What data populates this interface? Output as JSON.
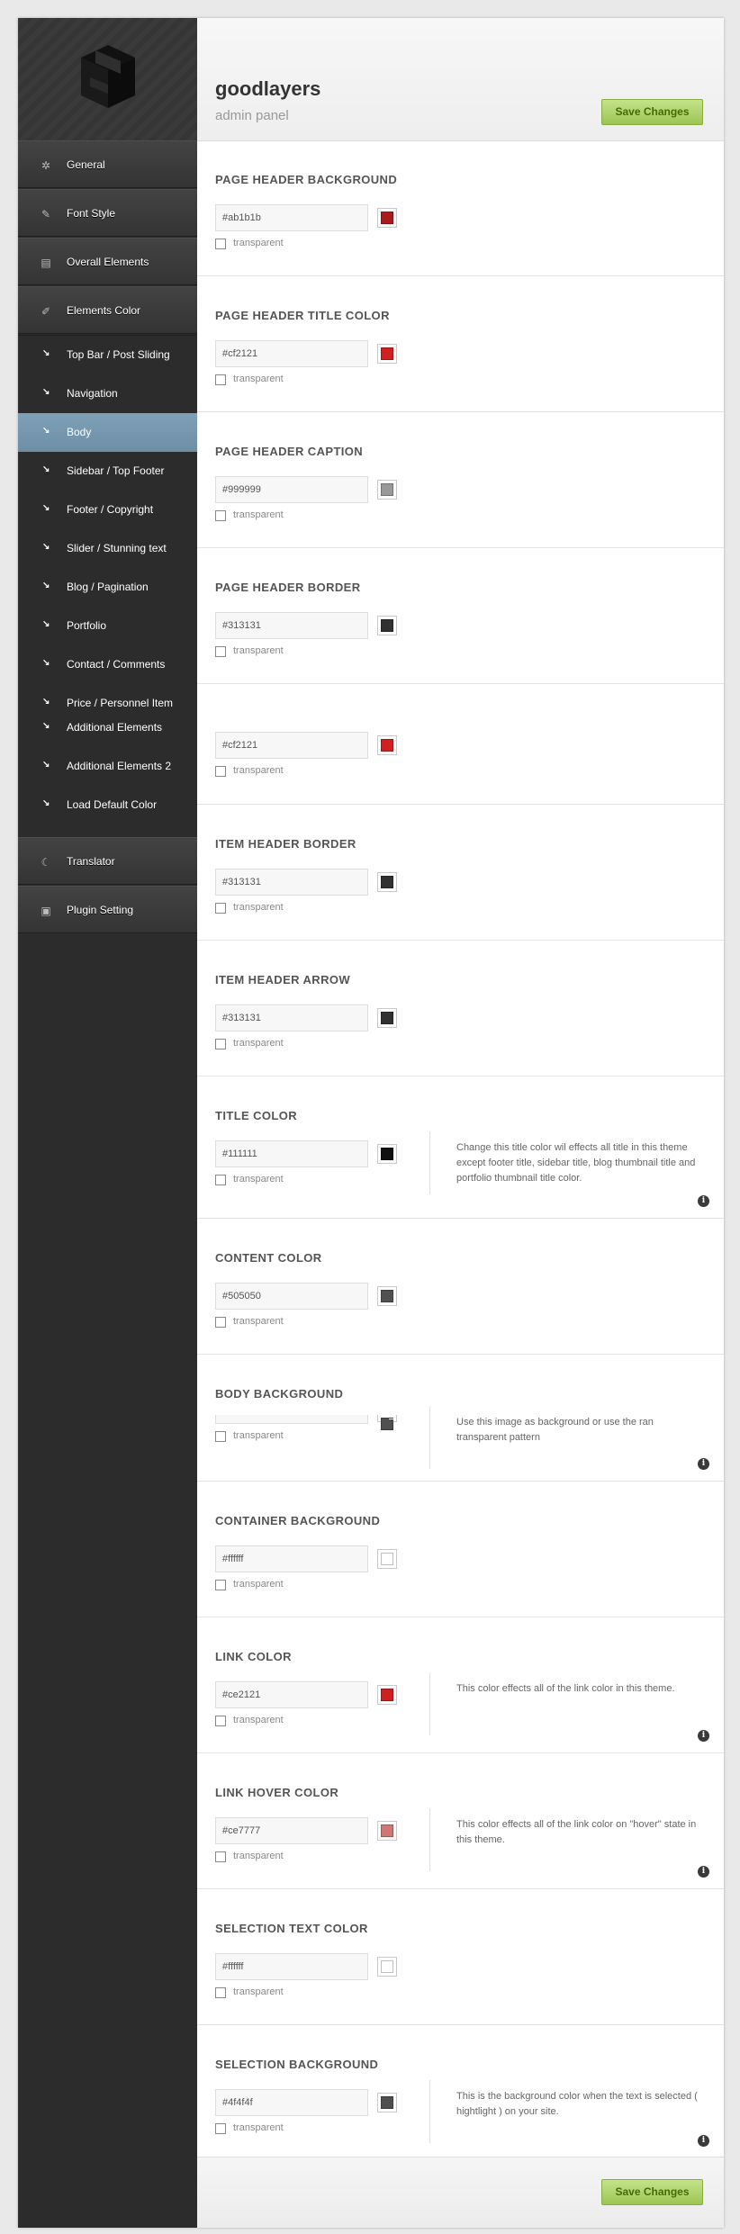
{
  "brand": {
    "title": "goodlayers",
    "subtitle": "admin panel"
  },
  "save_label": "Save Changes",
  "nav": {
    "main_top": [
      {
        "label": "General",
        "icon": "gear-icon",
        "glyph": "✲"
      },
      {
        "label": "Font Style",
        "icon": "pencil-icon",
        "glyph": "✎"
      },
      {
        "label": "Overall Elements",
        "icon": "layout-icon",
        "glyph": "▤"
      },
      {
        "label": "Elements Color",
        "icon": "brush-icon",
        "glyph": "✐"
      }
    ],
    "sub": [
      {
        "label": "Top Bar / Post Sliding"
      },
      {
        "label": "Navigation"
      },
      {
        "label": "Body"
      },
      {
        "label": "Sidebar / Top Footer"
      },
      {
        "label": "Footer / Copyright"
      },
      {
        "label": "Slider / Stunning text"
      },
      {
        "label": "Blog / Pagination"
      },
      {
        "label": "Portfolio"
      },
      {
        "label": "Contact / Comments"
      },
      {
        "label": "Price / Personnel Item"
      },
      {
        "label": "Additional Elements"
      },
      {
        "label": "Additional Elements 2"
      },
      {
        "label": "Load Default Color"
      }
    ],
    "active_sub": "Body",
    "main_bottom": [
      {
        "label": "Translator",
        "icon": "translator-icon",
        "glyph": "☾"
      },
      {
        "label": "Plugin Setting",
        "icon": "plugin-icon",
        "glyph": "▣"
      }
    ]
  },
  "transparent_label": "transparent",
  "sections": [
    {
      "title": "PAGE HEADER BACKGROUND",
      "value": "#ab1b1b",
      "color": "#ab1b1b",
      "desc": ""
    },
    {
      "title": "PAGE HEADER TITLE COLOR",
      "value": "#cf2121",
      "color": "#cf2121",
      "desc": ""
    },
    {
      "title": "PAGE HEADER CAPTION",
      "value": "#999999",
      "color": "#999999",
      "desc": ""
    },
    {
      "title": "PAGE HEADER BORDER",
      "value": "#313131",
      "color": "#313131",
      "desc": ""
    },
    {
      "title": "",
      "value": "#cf2121",
      "color": "#cf2121",
      "desc": ""
    },
    {
      "title": "ITEM HEADER BORDER",
      "value": "#313131",
      "color": "#313131",
      "desc": ""
    },
    {
      "title": "ITEM HEADER ARROW",
      "value": "#313131",
      "color": "#313131",
      "desc": ""
    },
    {
      "title": "TITLE COLOR",
      "value": "#111111",
      "color": "#111111",
      "desc": "Change this title color wil effects all title in this theme except footer title, sidebar title, blog thumbnail title and portfolio thumbnail title color."
    },
    {
      "title": "CONTENT COLOR",
      "value": "#505050",
      "color": "#505050",
      "desc": ""
    },
    {
      "title": "BODY BACKGROUND",
      "value": "",
      "color": "#505050",
      "desc": "Use this image as background or use the ran transparent pattern"
    },
    {
      "title": "CONTAINER BACKGROUND",
      "value": "#ffffff",
      "color": "#ffffff",
      "desc": ""
    },
    {
      "title": "LINK COLOR",
      "value": "#ce2121",
      "color": "#ce2121",
      "desc": "This color effects all of the link color in this theme."
    },
    {
      "title": "LINK HOVER COLOR",
      "value": "#ce7777",
      "color": "#ce7777",
      "desc": "This color effects all of the link color on \"hover\" state in this theme."
    },
    {
      "title": "SELECTION TEXT COLOR",
      "value": "#ffffff",
      "color": "#ffffff",
      "desc": ""
    },
    {
      "title": "SELECTION BACKGROUND",
      "value": "#4f4f4f",
      "color": "#4f4f4f",
      "desc": "This is the background color when the text is selected ( hightlight ) on your site."
    }
  ]
}
